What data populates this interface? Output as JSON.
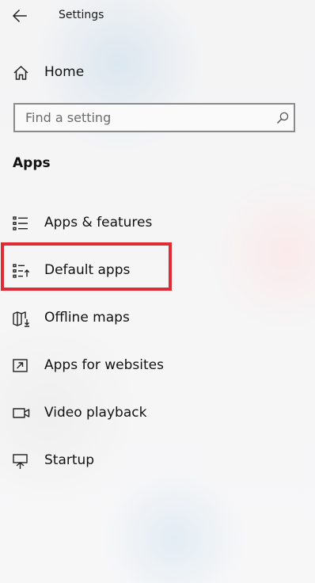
{
  "window": {
    "title": "Settings"
  },
  "nav": {
    "back_icon": "back-arrow-icon",
    "home": {
      "label": "Home",
      "icon": "home-icon"
    }
  },
  "search": {
    "placeholder": "Find a setting",
    "value": "",
    "icon": "search-icon"
  },
  "section": {
    "heading": "Apps",
    "items": [
      {
        "label": "Apps & features",
        "icon": "apps-features-icon",
        "selected": false
      },
      {
        "label": "Default apps",
        "icon": "default-apps-icon",
        "selected": false
      },
      {
        "label": "Offline maps",
        "icon": "offline-maps-icon",
        "selected": false
      },
      {
        "label": "Apps for websites",
        "icon": "apps-for-websites-icon",
        "selected": false
      },
      {
        "label": "Video playback",
        "icon": "video-playback-icon",
        "selected": false
      },
      {
        "label": "Startup",
        "icon": "startup-icon",
        "selected": false
      }
    ]
  },
  "annotation": {
    "highlighted_item": "Default apps",
    "highlight_color": "#e02b35"
  },
  "colors": {
    "text": "#111111",
    "search_border": "#8a8a8a"
  }
}
